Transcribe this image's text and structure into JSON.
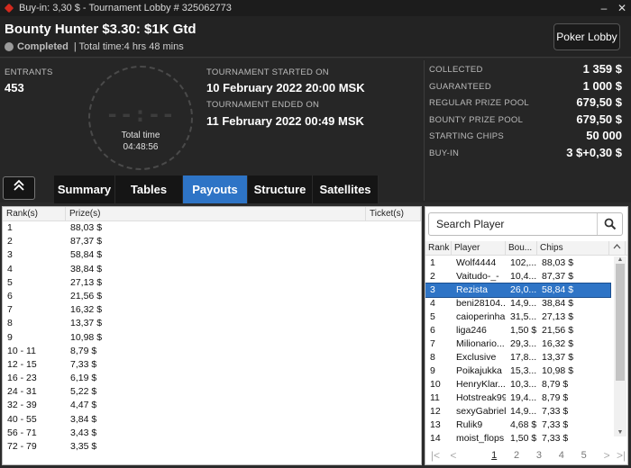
{
  "window": {
    "title": "Buy-in: 3,30 $ - Tournament Lobby # 325062773",
    "minimize": "–",
    "close": "✕"
  },
  "header": {
    "tournament_name": "Bounty Hunter $3.30: $1K Gtd",
    "status": "Completed",
    "total_time": "| Total time:4 hrs  48 mins",
    "lobby_button": "Poker Lobby"
  },
  "info": {
    "entrants_label": "ENTRANTS",
    "entrants_value": "453",
    "clock_digits": "--:--",
    "clock_label": "Total time",
    "clock_value": "04:48:56",
    "started_label": "TOURNAMENT STARTED ON",
    "started_value": "10 February 2022  20:00 MSK",
    "ended_label": "TOURNAMENT ENDED ON",
    "ended_value": "11 February 2022  00:49 MSK",
    "stats": [
      {
        "label": "COLLECTED",
        "value": "1 359 $"
      },
      {
        "label": "GUARANTEED",
        "value": "1 000 $"
      },
      {
        "label": "REGULAR PRIZE POOL",
        "value": "679,50 $"
      },
      {
        "label": "BOUNTY PRIZE POOL",
        "value": "679,50 $"
      },
      {
        "label": "STARTING CHIPS",
        "value": "50 000"
      },
      {
        "label": "BUY-IN",
        "value": "3 $+0,30 $"
      }
    ]
  },
  "collapse_button": "«",
  "tabs": [
    {
      "label": "Summary",
      "active": false
    },
    {
      "label": "Tables",
      "active": false
    },
    {
      "label": "Payouts",
      "active": true
    },
    {
      "label": "Structure",
      "active": false
    },
    {
      "label": "Satellites",
      "active": false
    }
  ],
  "payouts": {
    "headers": {
      "rank": "Rank(s)",
      "prize": "Prize(s)",
      "ticket": "Ticket(s)"
    },
    "rows": [
      {
        "rank": "1",
        "prize": "88,03 $"
      },
      {
        "rank": "2",
        "prize": "87,37 $"
      },
      {
        "rank": "3",
        "prize": "58,84 $"
      },
      {
        "rank": "4",
        "prize": "38,84 $"
      },
      {
        "rank": "5",
        "prize": "27,13 $"
      },
      {
        "rank": "6",
        "prize": "21,56 $"
      },
      {
        "rank": "7",
        "prize": "16,32 $"
      },
      {
        "rank": "8",
        "prize": "13,37 $"
      },
      {
        "rank": "9",
        "prize": "10,98 $"
      },
      {
        "rank": "10 - 11",
        "prize": "8,79 $"
      },
      {
        "rank": "12 - 15",
        "prize": "7,33 $"
      },
      {
        "rank": "16 - 23",
        "prize": "6,19 $"
      },
      {
        "rank": "24 - 31",
        "prize": "5,22 $"
      },
      {
        "rank": "32 - 39",
        "prize": "4,47 $"
      },
      {
        "rank": "40 - 55",
        "prize": "3,84 $"
      },
      {
        "rank": "56 - 71",
        "prize": "3,43 $"
      },
      {
        "rank": "72 - 79",
        "prize": "3,35 $"
      }
    ]
  },
  "players": {
    "search_placeholder": "Search Player",
    "headers": {
      "rank": "Rank",
      "player": "Player",
      "bounty": "Bou...",
      "chips": "Chips"
    },
    "rows": [
      {
        "rank": "1",
        "player": "Wolf4444",
        "bounty": "102,...",
        "chips": "88,03 $",
        "selected": false
      },
      {
        "rank": "2",
        "player": "Vaitudo-_-",
        "bounty": "10,4...",
        "chips": "87,37 $",
        "selected": false
      },
      {
        "rank": "3",
        "player": "Rezista",
        "bounty": "26,0...",
        "chips": "58,84 $",
        "selected": true
      },
      {
        "rank": "4",
        "player": "beni28104...",
        "bounty": "14,9...",
        "chips": "38,84 $",
        "selected": false
      },
      {
        "rank": "5",
        "player": "caioperinha",
        "bounty": "31,5...",
        "chips": "27,13 $",
        "selected": false
      },
      {
        "rank": "6",
        "player": "liga246",
        "bounty": "1,50 $",
        "chips": "21,56 $",
        "selected": false
      },
      {
        "rank": "7",
        "player": "Milionario...",
        "bounty": "29,3...",
        "chips": "16,32 $",
        "selected": false
      },
      {
        "rank": "8",
        "player": "Exclusive",
        "bounty": "17,8...",
        "chips": "13,37 $",
        "selected": false
      },
      {
        "rank": "9",
        "player": "Poikajukka",
        "bounty": "15,3...",
        "chips": "10,98 $",
        "selected": false
      },
      {
        "rank": "10",
        "player": "HenryKlar...",
        "bounty": "10,3...",
        "chips": "8,79 $",
        "selected": false
      },
      {
        "rank": "11",
        "player": "Hotstreak99",
        "bounty": "19,4...",
        "chips": "8,79 $",
        "selected": false
      },
      {
        "rank": "12",
        "player": "sexyGabriel...",
        "bounty": "14,9...",
        "chips": "7,33 $",
        "selected": false
      },
      {
        "rank": "13",
        "player": "Rulik9",
        "bounty": "4,68 $",
        "chips": "7,33 $",
        "selected": false
      },
      {
        "rank": "14",
        "player": "moist_flops",
        "bounty": "1,50 $",
        "chips": "7,33 $",
        "selected": false
      }
    ],
    "pager": {
      "first": "|<",
      "prev": "<",
      "pages": [
        "1",
        "2",
        "3",
        "4",
        "5"
      ],
      "current": "1",
      "next": ">",
      "last": ">|"
    }
  }
}
